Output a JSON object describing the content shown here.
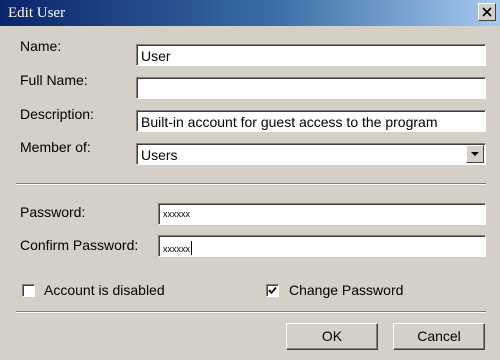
{
  "window": {
    "title": "Edit User",
    "close_icon": "close-icon"
  },
  "form": {
    "name": {
      "label": "Name:",
      "value": "User"
    },
    "full_name": {
      "label": "Full Name:",
      "value": ""
    },
    "description": {
      "label": "Description:",
      "value": "Built-in account for guest access to the program"
    },
    "member_of": {
      "label": "Member of:",
      "value": "Users",
      "icon": "chevron-down-icon"
    },
    "password": {
      "label": "Password:",
      "value": "xxxxxx"
    },
    "confirm_password": {
      "label": "Confirm Password:",
      "value": "xxxxxx"
    }
  },
  "options": {
    "account_disabled": {
      "label": "Account is disabled",
      "checked": false
    },
    "change_password": {
      "label": "Change Password",
      "checked": true
    }
  },
  "buttons": {
    "ok": "OK",
    "cancel": "Cancel"
  }
}
